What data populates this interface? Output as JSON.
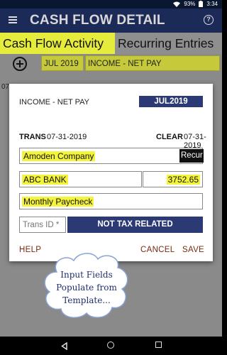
{
  "status": {
    "battery": "93%",
    "time": "3:34"
  },
  "appbar": {
    "title": "CASH FLOW DETAIL",
    "help_glyph": "?"
  },
  "tabs": [
    {
      "label": "Cash Flow Activity",
      "active": true
    },
    {
      "label": "Recurring Entries",
      "active": false
    }
  ],
  "filters": {
    "month": "JUL 2019",
    "account": "INCOME - NET PAY"
  },
  "background_text": "07-3",
  "dialog": {
    "account": "INCOME - NET PAY",
    "month": "JUL2019",
    "trans_label": "TRANS",
    "trans_date": "07-31-2019",
    "clear_label": "CLEAR",
    "clear_date": "07-31-2019",
    "payee": "Amoden Company",
    "recur_label": "Recur",
    "bank": "ABC BANK",
    "amount": "3752.65",
    "memo": "Monthly Paycheck",
    "trans_id_placeholder": "Trans ID *",
    "tax_button": "NOT TAX RELATED",
    "help": "HELP",
    "cancel": "CANCEL",
    "save": "SAVE"
  },
  "callout": {
    "line1": "Input Fields",
    "line2": "Populate from",
    "line3": "Template..."
  },
  "colors": {
    "appbar": "#1b2a56",
    "accent_yellow": "#e6ec3c",
    "navy_button": "#2b3a74",
    "action_text": "#7a2a12",
    "highlight": "#f4f43a"
  }
}
